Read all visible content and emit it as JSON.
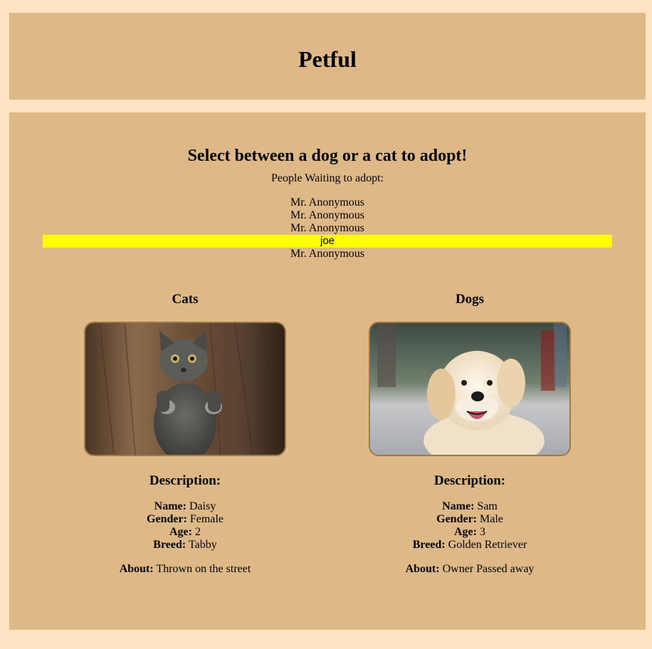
{
  "header": {
    "title": "Petful"
  },
  "main": {
    "subtitle": "Select between a dog or a cat to adopt!",
    "waiting_label": "People Waiting to adopt:",
    "queue": [
      "Mr. Anonymous",
      "Mr. Anonymous",
      "Mr. Anonymous",
      "joe",
      "Mr. Anonymous"
    ],
    "highlight_color": "#ffff00"
  },
  "cats": {
    "heading": "Cats",
    "image_icon": "cat-photo",
    "description_title": "Description:",
    "name_label": "Name:",
    "name": "Daisy",
    "gender_label": "Gender:",
    "gender": "Female",
    "age_label": "Age:",
    "age": "2",
    "breed_label": "Breed:",
    "breed": "Tabby",
    "about_label": "About:",
    "about": "Thrown on the street"
  },
  "dogs": {
    "heading": "Dogs",
    "image_icon": "dog-photo",
    "description_title": "Description:",
    "name_label": "Name:",
    "name": "Sam",
    "gender_label": "Gender:",
    "gender": "Male",
    "age_label": "Age:",
    "age": "3",
    "breed_label": "Breed:",
    "breed": "Golden Retriever",
    "about_label": "About:",
    "about": "Owner Passed away"
  },
  "colors": {
    "page_background": "#ffe4c4",
    "panel_background": "#deb887"
  }
}
